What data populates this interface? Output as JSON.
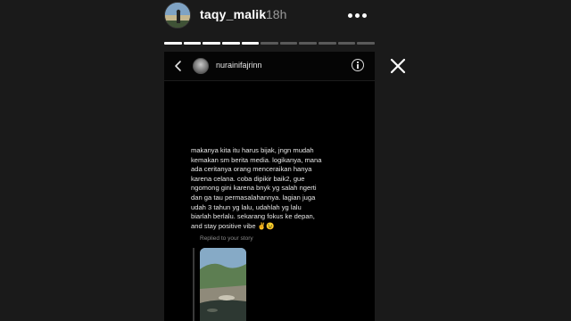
{
  "story": {
    "username": "taqy_malik",
    "time": "18h",
    "progress": {
      "segments": 11,
      "completed": 5
    }
  },
  "dm": {
    "contact_name": "nurainifajrinn",
    "message": "makanya kita itu harus bijak, jngn mudah\nkemakan sm berita media. logikanya, mana\nada ceritanya orang menceraikan hanya\nkarena celana. coba dipikir baik2, gue\nngomong gini karena bnyk yg salah ngerti\ndan ga tau permasalahannya. lagian juga\nudah 3 tahun yg lalu, udahlah yg lalu\nbiarlah berlalu. sekarang fokus ke depan,\nand stay positive vibe ✌️😉",
    "replied_label": "Replied to your story"
  },
  "icons": {
    "more": "more-horizontal-icon",
    "close": "close-icon",
    "back": "chevron-left-icon",
    "info": "info-icon"
  },
  "colors": {
    "background": "#1a1a1a",
    "card": "#000000",
    "text": "#ffffff",
    "muted": "#9a9a9a"
  }
}
